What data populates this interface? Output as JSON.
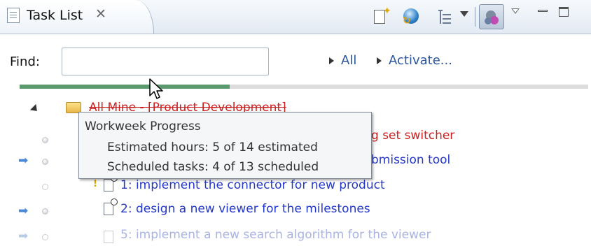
{
  "view": {
    "tab_title": "Task List",
    "tab_close_glyph": "✕",
    "toolbar_icons": [
      "new-task-icon",
      "synchronize-icon",
      "presentation-icon",
      "focus-on-workweek-icon",
      "view-menu-icon",
      "minimize-icon",
      "maximize-icon"
    ]
  },
  "find_bar": {
    "label": "Find:",
    "input_value": "",
    "links": [
      "All",
      "Activate..."
    ]
  },
  "workweek_progress": {
    "fraction": 0.37,
    "fill_color": "#5b9a6e"
  },
  "tasks": {
    "category": "All Mine - [Product Development]",
    "rows": [
      {
        "label": "g set switcher",
        "color": "#cc1f1f",
        "incoming": false,
        "dot": "grey"
      },
      {
        "label": "bmission tool",
        "color": "#2438c8",
        "incoming": true,
        "dot": "grey"
      },
      {
        "label": "1: implement the connector for new product",
        "color": "#2438c8",
        "incoming": false,
        "dot": "empty"
      },
      {
        "label": "2: design a new viewer for the milestones",
        "color": "#2438c8",
        "incoming": true,
        "dot": "grey"
      },
      {
        "label": "5: implement a new search algorithm for the viewer",
        "color": "#a9b3e6",
        "incoming": true,
        "dot": "empty"
      }
    ]
  },
  "tooltip": {
    "title": "Workweek Progress",
    "estimated": "Estimated hours: 5 of 14 estimated",
    "scheduled": "Scheduled tasks: 4 of 13 scheduled"
  }
}
